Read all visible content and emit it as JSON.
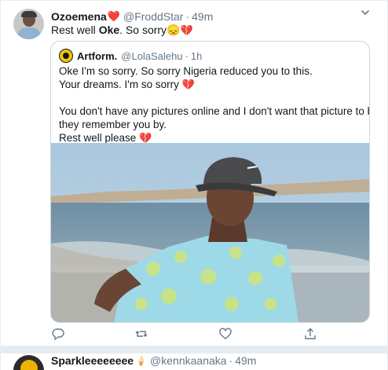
{
  "tweet": {
    "author_name": "Ozoemena",
    "author_badge": "❤️",
    "handle": "@FroddStar",
    "separator": "·",
    "time": "49m",
    "text_prefix": "Rest well ",
    "text_bold": "Oke",
    "text_suffix": ". So sorry",
    "text_emoji_sad": "😞",
    "text_emoji_heart": "💔"
  },
  "quote": {
    "author_name": "Artform.",
    "handle": "@LolaSalehu",
    "separator": "·",
    "time": "1h",
    "lines": [
      "Oke I'm so sorry. So sorry Nigeria reduced you to this.",
      "Your dreams. I'm so sorry",
      "You don't have any pictures online and I don't want that picture to be all",
      "they remember you by.",
      "Rest well please"
    ],
    "heart_emoji": "💔"
  },
  "next_tweet": {
    "author_name": "Sparkleeeeeeee",
    "author_emoji": "🍦",
    "handle": "@kennkaanaka",
    "separator": "·",
    "time": "49m"
  },
  "colors": {
    "accent": "#1da1f2",
    "muted": "#657786",
    "heart": "#e0245e",
    "border": "#ccd6dd"
  },
  "icons": {
    "reply": "reply-icon",
    "retweet": "retweet-icon",
    "like": "like-icon",
    "share": "share-icon",
    "menu": "chevron-down-icon"
  }
}
